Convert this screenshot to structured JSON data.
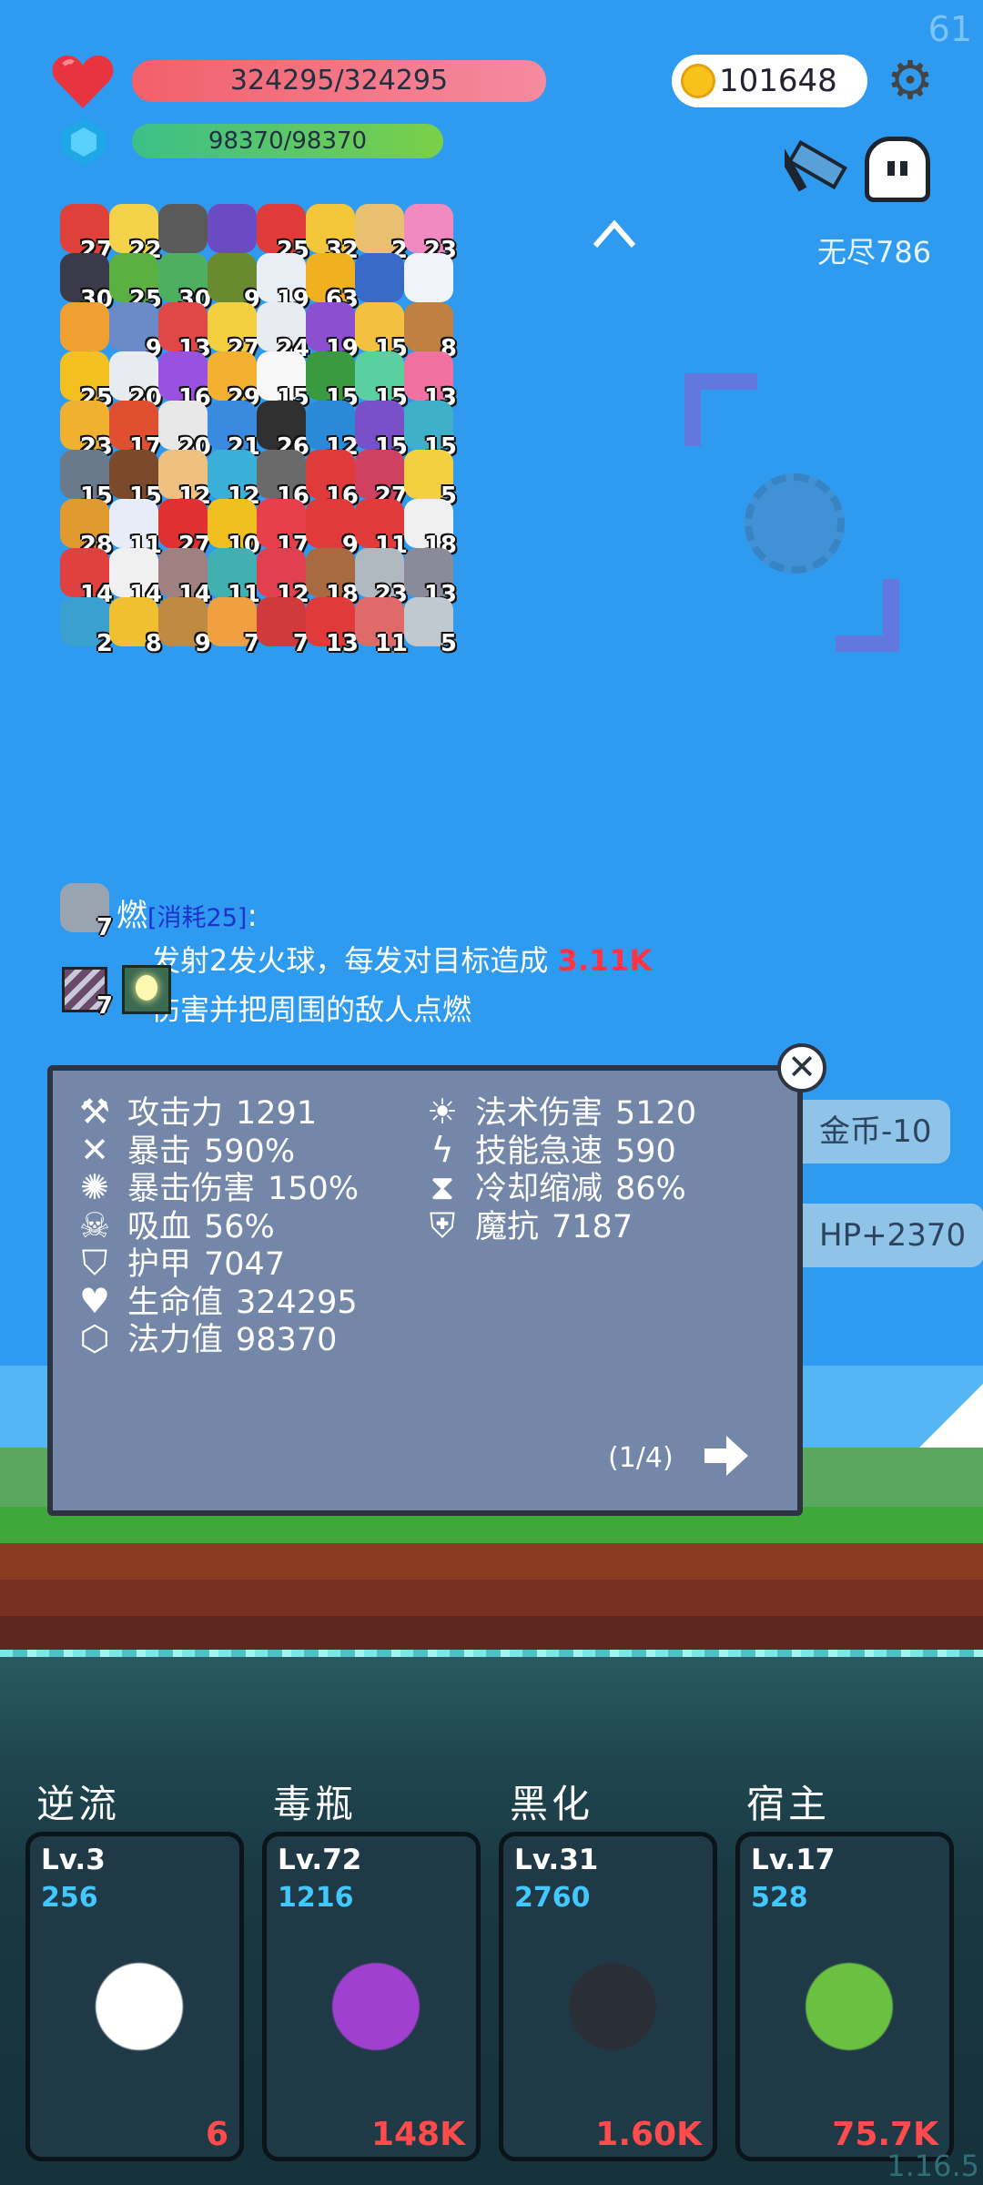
{
  "fps": "61",
  "version": "1.16.5",
  "hp": {
    "current": 324295,
    "max": 324295,
    "label": "324295/324295",
    "fraction": 1.0
  },
  "mp": {
    "current": 98370,
    "max": 98370,
    "label": "98370/98370",
    "fraction": 1.0
  },
  "coins": "101648",
  "mode": "无尽786",
  "colors": {
    "sky": "#2f9bf0",
    "hp": "#f2606a",
    "mp": "#3bbf8a",
    "panel": "#7487a8",
    "accent_red": "#ff3344",
    "power_blue": "#43c7ff"
  },
  "items": [
    {
      "icon": "sock-icon",
      "count": "27",
      "color": "#e0403a"
    },
    {
      "icon": "flower-icon",
      "count": "22",
      "color": "#f4d24a"
    },
    {
      "icon": "mortar-icon",
      "count": "",
      "color": "#5a5a5a"
    },
    {
      "icon": "wizard-hat-icon",
      "count": "",
      "color": "#6b4bc4"
    },
    {
      "icon": "mushroom-icon",
      "count": "25",
      "color": "#e03a3a"
    },
    {
      "icon": "sun-cloud-icon",
      "count": "32",
      "color": "#f4c63a"
    },
    {
      "icon": "scroll-icon",
      "count": "2",
      "color": "#e8c070"
    },
    {
      "icon": "ice-cream-icon",
      "count": "23",
      "color": "#f08ac0"
    },
    {
      "icon": "bat-icon",
      "count": "30",
      "color": "#3a3a4a"
    },
    {
      "icon": "zombie-icon",
      "count": "25",
      "color": "#5ab040"
    },
    {
      "icon": "money-heart-icon",
      "count": "30",
      "color": "#4cb060"
    },
    {
      "icon": "grenade-icon",
      "count": "9",
      "color": "#6a8a30"
    },
    {
      "icon": "cloud-icon",
      "count": "19",
      "color": "#e8eef4"
    },
    {
      "icon": "coins-icon",
      "count": "63",
      "color": "#f0b020"
    },
    {
      "icon": "tarot-icon",
      "count": "",
      "color": "#3a6ac8"
    },
    {
      "icon": "list-icon",
      "count": "",
      "color": "#f0f4f8"
    },
    {
      "icon": "map-icon",
      "count": "",
      "color": "#f0a030"
    },
    {
      "icon": "shield-icon",
      "count": "9",
      "color": "#6a8ac8"
    },
    {
      "icon": "pill-icon",
      "count": "13",
      "color": "#e04848"
    },
    {
      "icon": "star-card-icon",
      "count": "27",
      "color": "#f4d040"
    },
    {
      "icon": "envelope-icon",
      "count": "24",
      "color": "#e8ecf0"
    },
    {
      "icon": "box-icon",
      "count": "19",
      "color": "#8a50d0"
    },
    {
      "icon": "magic-wand-icon",
      "count": "15",
      "color": "#f4c040"
    },
    {
      "icon": "noose-icon",
      "count": "8",
      "color": "#c08040"
    },
    {
      "icon": "crown-icon",
      "count": "25",
      "color": "#f4c020"
    },
    {
      "icon": "stopwatch-icon",
      "count": "20",
      "color": "#e8ecf0"
    },
    {
      "icon": "crystal-ball-icon",
      "count": "16",
      "color": "#9a50e0"
    },
    {
      "icon": "egg-icon",
      "count": "29",
      "color": "#f4b030"
    },
    {
      "icon": "ghost-icon",
      "count": "15",
      "color": "#f8f8f8"
    },
    {
      "icon": "helmet-icon",
      "count": "15",
      "color": "#3a9a40"
    },
    {
      "icon": "balloon-icon",
      "count": "15",
      "color": "#5ad0a0"
    },
    {
      "icon": "lotion-icon",
      "count": "13",
      "color": "#f070a0"
    },
    {
      "icon": "notepad-icon",
      "count": "23",
      "color": "#f0b030"
    },
    {
      "icon": "thermometer-icon",
      "count": "17",
      "color": "#e05030"
    },
    {
      "icon": "playing-cards-icon",
      "count": "20",
      "color": "#e8e8e8"
    },
    {
      "icon": "chat-bubble-icon",
      "count": "21",
      "color": "#3a8ae0"
    },
    {
      "icon": "cauldron-icon",
      "count": "26",
      "color": "#303030"
    },
    {
      "icon": "gem-icon",
      "count": "12",
      "color": "#2a8ad8"
    },
    {
      "icon": "purple-shield-icon",
      "count": "15",
      "color": "#7a50c8"
    },
    {
      "icon": "paper-icon",
      "count": "15",
      "color": "#40b0c8"
    },
    {
      "icon": "compass-icon",
      "count": "15",
      "color": "#6a7a8a"
    },
    {
      "icon": "coconut-icon",
      "count": "15",
      "color": "#7a4a2a"
    },
    {
      "icon": "fist-icon",
      "count": "12",
      "color": "#f0c080"
    },
    {
      "icon": "potion-icon",
      "count": "12",
      "color": "#3ab0d8"
    },
    {
      "icon": "spike-ball-icon",
      "count": "16",
      "color": "#6a6a6a"
    },
    {
      "icon": "strawberry-icon",
      "count": "16",
      "color": "#e03a3a"
    },
    {
      "icon": "jam-icon",
      "count": "27",
      "color": "#d04060"
    },
    {
      "icon": "halo-icon",
      "count": "5",
      "color": "#f4d040"
    },
    {
      "icon": "book-icon",
      "count": "28",
      "color": "#e09a30"
    },
    {
      "icon": "capsule-icon",
      "count": "11",
      "color": "#e8ecf8"
    },
    {
      "icon": "apple-icon",
      "count": "27",
      "color": "#e03030"
    },
    {
      "icon": "sunflower-icon",
      "count": "10",
      "color": "#f0c020"
    },
    {
      "icon": "heart-icon",
      "count": "17",
      "color": "#e8404a"
    },
    {
      "icon": "twin-hearts-icon",
      "count": "9",
      "color": "#e03a3a"
    },
    {
      "icon": "gift-icon",
      "count": "11",
      "color": "#e03a3a"
    },
    {
      "icon": "clipboard-icon",
      "count": "18",
      "color": "#f0f0f0"
    },
    {
      "icon": "watermelon-icon",
      "count": "14",
      "color": "#e04040"
    },
    {
      "icon": "dice-icon",
      "count": "14",
      "color": "#f0f0f0"
    },
    {
      "icon": "tombstone-icon",
      "count": "14",
      "color": "#a08080"
    },
    {
      "icon": "disc-icon",
      "count": "11",
      "color": "#40b0b0"
    },
    {
      "icon": "flask-icon",
      "count": "12",
      "color": "#e04050"
    },
    {
      "icon": "donut-shield-icon",
      "count": "18",
      "color": "#a86a40"
    },
    {
      "icon": "sword-icon",
      "count": "23",
      "color": "#b0b8c0"
    },
    {
      "icon": "elephant-icon",
      "count": "13",
      "color": "#8a8a9a"
    },
    {
      "icon": "target-icon",
      "count": "2",
      "color": "#3aa0d0"
    },
    {
      "icon": "ring-icon",
      "count": "8",
      "color": "#f0c030"
    },
    {
      "icon": "bow-icon",
      "count": "9",
      "color": "#c08a40"
    },
    {
      "icon": "scroll-orange-icon",
      "count": "7",
      "color": "#f0a040"
    },
    {
      "icon": "red-shield-icon",
      "count": "7",
      "color": "#d03a3a"
    },
    {
      "icon": "bookmark-icon",
      "count": "13",
      "color": "#e03a3a"
    },
    {
      "icon": "steak-icon",
      "count": "11",
      "color": "#e06a6a"
    },
    {
      "icon": "hook-icon",
      "count": "5",
      "color": "#c0c8d0"
    }
  ],
  "skill": {
    "icon_count": "7",
    "name": "燃",
    "cost": "[消耗25]",
    "cost_suffix": ":",
    "desc_before": "发射2发火球，每发对目标造成 ",
    "desc_value": "3.11K",
    "desc_after": " 伤害并把周围的敌人点燃",
    "sub_icon_count": "7"
  },
  "stats": {
    "left": [
      {
        "icon": "axe-icon",
        "glyph": "⚒",
        "label": "攻击力",
        "value": "1291"
      },
      {
        "icon": "crit-icon",
        "glyph": "✕",
        "label": "暴击",
        "value": "590%"
      },
      {
        "icon": "crit-damage-icon",
        "glyph": "✺",
        "label": "暴击伤害",
        "value": "150%"
      },
      {
        "icon": "skull-icon",
        "glyph": "☠",
        "label": "吸血",
        "value": "56%"
      },
      {
        "icon": "armor-icon",
        "glyph": "⛉",
        "label": "护甲",
        "value": "7047"
      },
      {
        "icon": "heart-icon",
        "glyph": "♥",
        "label": "生命值",
        "value": "324295"
      },
      {
        "icon": "mana-icon",
        "glyph": "⬡",
        "label": "法力值",
        "value": "98370"
      }
    ],
    "right": [
      {
        "icon": "sun-icon",
        "glyph": "☀",
        "label": "法术伤害",
        "value": "5120"
      },
      {
        "icon": "lightning-icon",
        "glyph": "ϟ",
        "label": "技能急速",
        "value": "590"
      },
      {
        "icon": "hourglass-icon",
        "glyph": "⧗",
        "label": "冷却缩减",
        "value": "86%"
      },
      {
        "icon": "magic-shield-icon",
        "glyph": "⛨",
        "label": "魔抗",
        "value": "7187"
      }
    ],
    "page": "(1/4)"
  },
  "side_pills": [
    "金币-10",
    "HP+2370"
  ],
  "cards": [
    {
      "title": "逆流",
      "level": "Lv.3",
      "power": "256",
      "damage": "6",
      "art": "cloud-wing-icon",
      "color": "#ffffff"
    },
    {
      "title": "毒瓶",
      "level": "Lv.72",
      "power": "1216",
      "damage": "148K",
      "art": "poison-bottle-icon",
      "color": "#a040d0"
    },
    {
      "title": "黑化",
      "level": "Lv.31",
      "power": "2760",
      "damage": "1.60K",
      "art": "dark-tree-icon",
      "color": "#2a2e36"
    },
    {
      "title": "宿主",
      "level": "Lv.17",
      "power": "528",
      "damage": "75.7K",
      "art": "green-monster-icon",
      "color": "#6ac040"
    }
  ]
}
